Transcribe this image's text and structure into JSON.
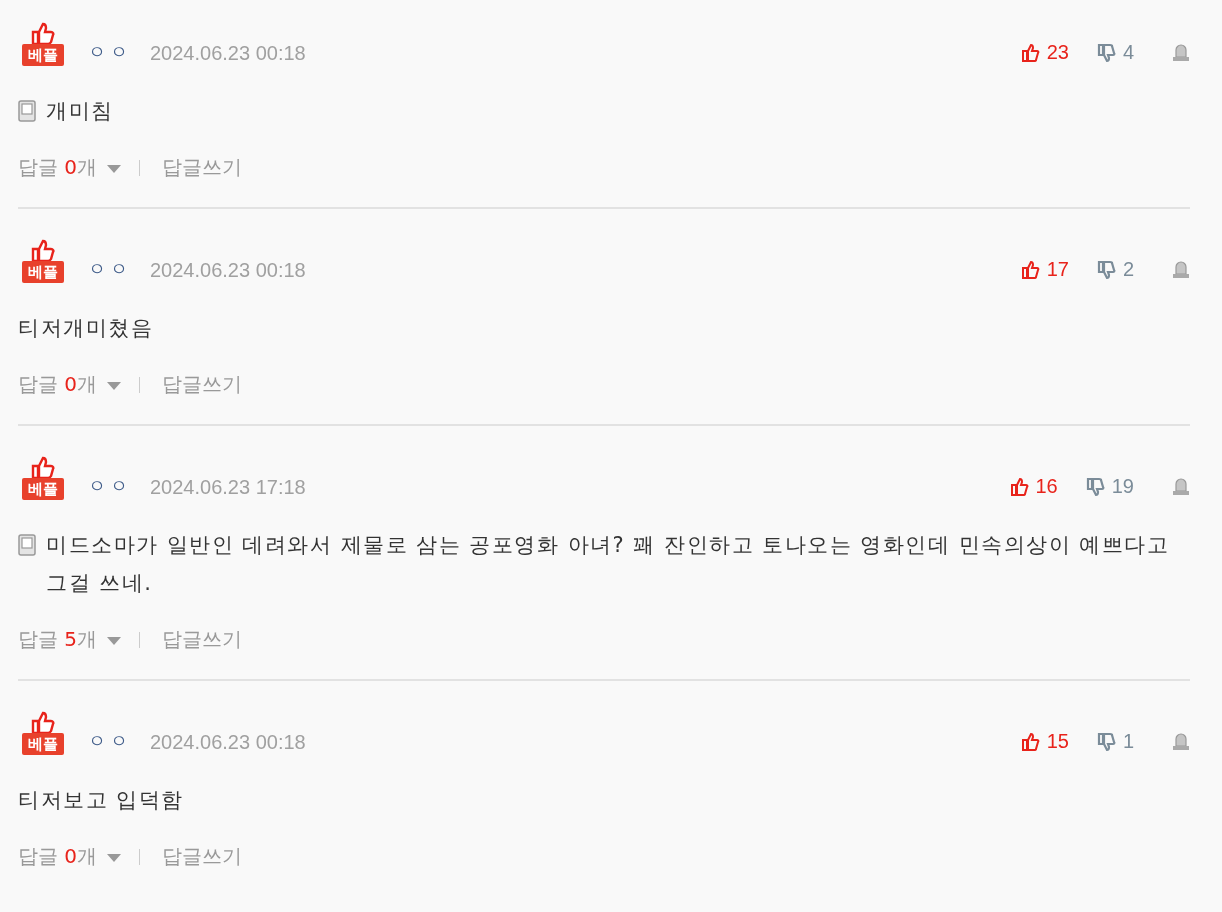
{
  "comments": [
    {
      "badge": "베플",
      "author": "ㅇㅇ",
      "date": "2024.06.23 00:18",
      "likes": "23",
      "dislikes": "4",
      "mobile": true,
      "text": "개미침",
      "reply_label": "답글",
      "reply_count": "0",
      "reply_unit": "개",
      "write_reply": "답글쓰기"
    },
    {
      "badge": "베플",
      "author": "ㅇㅇ",
      "date": "2024.06.23 00:18",
      "likes": "17",
      "dislikes": "2",
      "mobile": false,
      "text": "티저개미쳤음",
      "reply_label": "답글",
      "reply_count": "0",
      "reply_unit": "개",
      "write_reply": "답글쓰기"
    },
    {
      "badge": "베플",
      "author": "ㅇㅇ",
      "date": "2024.06.23 17:18",
      "likes": "16",
      "dislikes": "19",
      "mobile": true,
      "text": "미드소마가 일반인 데려와서 제물로 삼는 공포영화 아녀? 꽤 잔인하고 토나오는 영화인데 민속의상이 예쁘다고 그걸 쓰네.",
      "reply_label": "답글",
      "reply_count": "5",
      "reply_unit": "개",
      "write_reply": "답글쓰기"
    },
    {
      "badge": "베플",
      "author": "ㅇㅇ",
      "date": "2024.06.23 00:18",
      "likes": "15",
      "dislikes": "1",
      "mobile": false,
      "text": "티저보고 입덕함",
      "reply_label": "답글",
      "reply_count": "0",
      "reply_unit": "개",
      "write_reply": "답글쓰기"
    }
  ]
}
